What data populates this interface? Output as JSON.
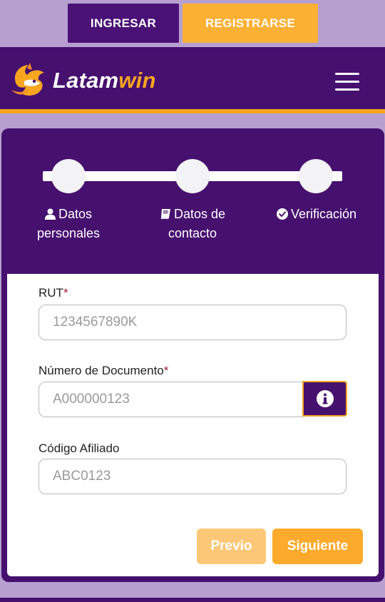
{
  "top_actions": {
    "login_label": "INGRESAR",
    "register_label": "REGISTRARSE"
  },
  "brand": {
    "name_part1": "Latam",
    "name_part2": "win"
  },
  "colors": {
    "primary": "#46106f",
    "accent": "#f7a51f",
    "background": "#b79fd0"
  },
  "stepper": {
    "steps": [
      {
        "label_line1": "Datos",
        "label_line2": "personales",
        "icon": "user-icon"
      },
      {
        "label_line1": "Datos de",
        "label_line2": "contacto",
        "icon": "book-icon"
      },
      {
        "label_line1": "Verificación",
        "label_line2": "",
        "icon": "check-circle-icon"
      }
    ]
  },
  "form": {
    "rut": {
      "label": "RUT",
      "required_mark": "*",
      "placeholder": "1234567890K"
    },
    "document": {
      "label": "Número de Documento",
      "required_mark": "*",
      "placeholder": "A000000123"
    },
    "affiliate": {
      "label": "Código Afiliado",
      "placeholder": "ABC0123"
    },
    "buttons": {
      "prev_label": "Previo",
      "next_label": "Siguiente"
    }
  }
}
